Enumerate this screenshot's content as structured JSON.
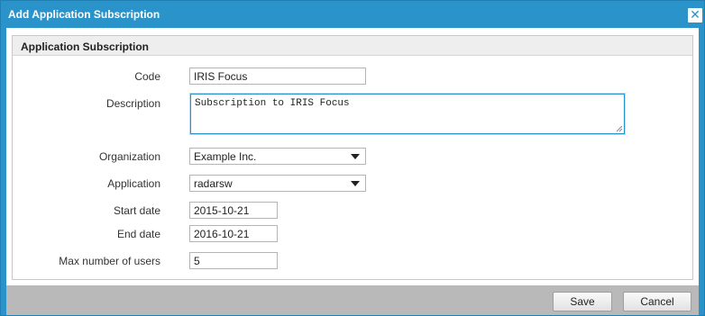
{
  "dialog": {
    "title": "Add Application Subscription",
    "close_symbol": "✕"
  },
  "section": {
    "legend": "Application Subscription"
  },
  "fields": {
    "code": {
      "label": "Code",
      "value": "IRIS Focus"
    },
    "description": {
      "label": "Description",
      "value": "Subscription to IRIS Focus"
    },
    "organization": {
      "label": "Organization",
      "value": "Example Inc."
    },
    "application": {
      "label": "Application",
      "value": "radarsw"
    },
    "start_date": {
      "label": "Start date",
      "value": "2015-10-21"
    },
    "end_date": {
      "label": "End date",
      "value": "2016-10-21"
    },
    "max_users": {
      "label": "Max number of users",
      "value": "5"
    }
  },
  "footer": {
    "save_label": "Save",
    "cancel_label": "Cancel"
  },
  "colors": {
    "titlebar": "#2a93c9",
    "footer": "#b9b9b9"
  }
}
